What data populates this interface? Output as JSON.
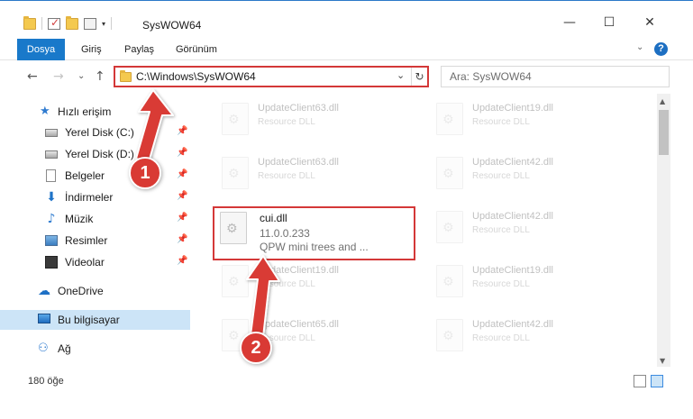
{
  "window": {
    "title": "SysWOW64",
    "minimize": "—",
    "maximize": "☐",
    "close": "✕"
  },
  "qat": {
    "dropdown": "▾"
  },
  "ribbon": {
    "tabs": [
      "Dosya",
      "Giriş",
      "Paylaş",
      "Görünüm"
    ],
    "collapse": "⌄",
    "help": "?"
  },
  "nav": {
    "back": "←",
    "forward": "→",
    "recent": "⌄",
    "up": "↑"
  },
  "address": {
    "path": "C:\\Windows\\SysWOW64",
    "dropdown": "⌄",
    "refresh": "↻"
  },
  "search": {
    "placeholder": "Ara: SysWOW64"
  },
  "sidebar": {
    "pin": "📌",
    "items": [
      {
        "label": "Hızlı erişim",
        "icon": "star-icon",
        "glyph": "★"
      },
      {
        "label": "Yerel Disk (C:)",
        "icon": "disk-icon"
      },
      {
        "label": "Yerel Disk (D:)",
        "icon": "disk-icon"
      },
      {
        "label": "Belgeler",
        "icon": "document-icon"
      },
      {
        "label": "İndirmeler",
        "icon": "download-icon",
        "glyph": "⬇"
      },
      {
        "label": "Müzik",
        "icon": "music-icon",
        "glyph": "♪"
      },
      {
        "label": "Resimler",
        "icon": "pictures-icon"
      },
      {
        "label": "Videolar",
        "icon": "video-icon"
      },
      {
        "label": "OneDrive",
        "icon": "cloud-icon",
        "glyph": "☁"
      },
      {
        "label": "Bu bilgisayar",
        "icon": "computer-icon"
      },
      {
        "label": "Ağ",
        "icon": "network-icon",
        "glyph": "⚇"
      }
    ]
  },
  "files": [
    {
      "name": "UpdateClient63.dll",
      "desc": "Resource DLL"
    },
    {
      "name": "UpdateClient19.dll",
      "desc": "Resource DLL"
    },
    {
      "name": "UpdateClient63.dll",
      "desc": "Resource DLL"
    },
    {
      "name": "UpdateClient42.dll",
      "desc": "Resource DLL"
    },
    {
      "name": "cui.dll",
      "version": "11.0.0.233",
      "desc": "QPW mini trees and ..."
    },
    {
      "name": "UpdateClient42.dll",
      "desc": "Resource DLL"
    },
    {
      "name": "UpdateClient19.dll",
      "desc": "Resource DLL"
    },
    {
      "name": "UpdateClient19.dll",
      "desc": "Resource DLL"
    },
    {
      "name": "UpdateClient65.dll",
      "desc": "Resource DLL"
    },
    {
      "name": "UpdateClient42.dll",
      "desc": "Resource DLL"
    }
  ],
  "scroll": {
    "up": "▲",
    "down": "▼"
  },
  "status": {
    "count": "180 öğe"
  },
  "annotations": {
    "step1": "1",
    "step2": "2"
  },
  "colors": {
    "accent": "#1979ca",
    "highlight": "#d43838",
    "badge": "#d93a34",
    "selected": "#cce4f7"
  }
}
